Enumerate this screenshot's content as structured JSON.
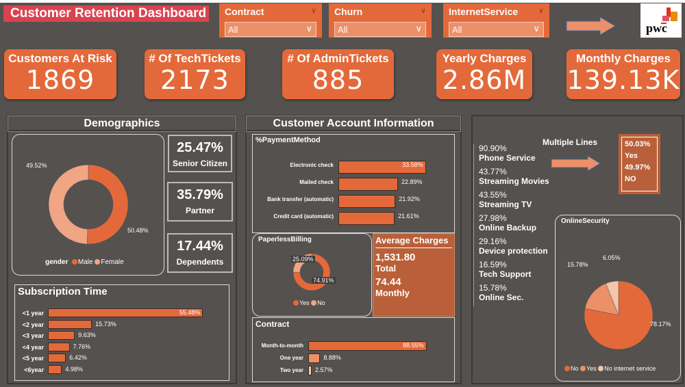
{
  "title": "Customer Retention Dashboard",
  "slicers": [
    {
      "label": "Contract",
      "value": "All"
    },
    {
      "label": "Churn",
      "value": "All"
    },
    {
      "label": "InternetService",
      "value": "All"
    }
  ],
  "logo": "pwc",
  "kpis": [
    {
      "label": "Customers At Risk",
      "value": "1869"
    },
    {
      "label": "# Of TechTickets",
      "value": "2173"
    },
    {
      "label": "# Of AdminTickets",
      "value": "885"
    },
    {
      "label": "Yearly Charges",
      "value": "2.86M"
    },
    {
      "label": "Monthly Charges",
      "value": "139.13K"
    }
  ],
  "colors": {
    "accent": "#e4693a",
    "light": "#ec9068",
    "pale": "#f4c4ac",
    "title_bg": "#d9434f",
    "bg": "#55514e",
    "card": "#b9603a"
  },
  "demographics": {
    "title": "Demographics",
    "gender": {
      "legend_title": "gender",
      "slices": [
        {
          "name": "Male",
          "value": 50.48,
          "label": "50.48%"
        },
        {
          "name": "Female",
          "value": 49.52,
          "label": "49.52%"
        }
      ]
    },
    "stats": [
      {
        "value": "25.47%",
        "label": "Senior Citizen"
      },
      {
        "value": "35.79%",
        "label": "Partner"
      },
      {
        "value": "17.44%",
        "label": "Dependents"
      }
    ],
    "subscription": {
      "title": "Subscription Time",
      "bars": [
        {
          "label": "<1 year",
          "value": 55.48,
          "text": "55.48%"
        },
        {
          "label": "<2 year",
          "value": 15.73,
          "text": "15.73%"
        },
        {
          "label": "<3 year",
          "value": 9.63,
          "text": "9.63%"
        },
        {
          "label": "<4 year",
          "value": 7.76,
          "text": "7.76%"
        },
        {
          "label": "<5 year",
          "value": 6.42,
          "text": "6.42%"
        },
        {
          "label": "<6year",
          "value": 4.98,
          "text": "4.98%"
        }
      ]
    }
  },
  "account": {
    "title": "Customer Account Information",
    "payment": {
      "title": "%PaymentMethod",
      "bars": [
        {
          "label": "Electronic check",
          "value": 33.58,
          "text": "33.58%"
        },
        {
          "label": "Mailed check",
          "value": 22.89,
          "text": "22.89%"
        },
        {
          "label": "Bank transfer (automatic)",
          "value": 21.92,
          "text": "21.92%"
        },
        {
          "label": "Credit card (automatic)",
          "value": 21.61,
          "text": "21.61%"
        }
      ]
    },
    "paperless": {
      "title": "PaperlessBilling",
      "slices": [
        {
          "name": "Yes",
          "value": 74.91,
          "label": "74.91%"
        },
        {
          "name": "No",
          "value": 25.09,
          "label": "25.09%"
        }
      ]
    },
    "average": {
      "title": "Average Charges",
      "total": "1,531.80",
      "total_label": "Total",
      "monthly": "74.44",
      "monthly_label": "Monthly"
    },
    "contract": {
      "title": "Contract",
      "bars": [
        {
          "label": "Month-to-month",
          "value": 88.55,
          "text": "88.55%"
        },
        {
          "label": "One year",
          "value": 8.88,
          "text": "8.88%"
        },
        {
          "label": "Two year",
          "value": 2.57,
          "text": "2.57%"
        }
      ]
    }
  },
  "services": {
    "items": [
      {
        "pct": "90.90%",
        "name": "Phone Service"
      },
      {
        "pct": "43.77%",
        "name": "Streaming Movies"
      },
      {
        "pct": "43.55%",
        "name": "Streaming TV"
      },
      {
        "pct": "27.98%",
        "name": "Online Backup"
      },
      {
        "pct": "29.16%",
        "name": "Device protection"
      },
      {
        "pct": "16.59%",
        "name": "Tech Support"
      },
      {
        "pct": "15.78%",
        "name": "Online Sec."
      }
    ],
    "multiple_lines": {
      "title": "Multiple Lines",
      "yes_pct": "50.03%",
      "yes": "Yes",
      "no_pct": "49.97%",
      "no": "NO"
    },
    "online_security": {
      "title": "OnlineSecurity",
      "slices": [
        {
          "name": "No",
          "value": 78.17,
          "label": "78.17%"
        },
        {
          "name": "Yes",
          "value": 15.78,
          "label": "15.78%"
        },
        {
          "name": "No internet service",
          "value": 6.05,
          "label": "6.05%"
        }
      ]
    }
  }
}
